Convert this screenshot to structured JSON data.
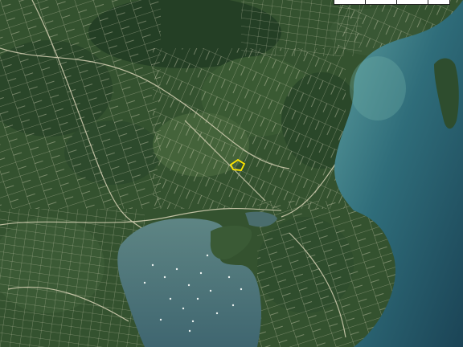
{
  "map": {
    "type": "satellite-parcel-map",
    "colors": {
      "forest_dark": "#1f3a22",
      "forest": "#34522f",
      "forest_light": "#5a7441",
      "sea_deep": "#1b4456",
      "sea_shallow": "#4e8e92",
      "bay": "#4f7579",
      "parcel_line": "#e8e2c8",
      "selected_parcel": "#ffe600",
      "scale_bar": "#ffffff"
    },
    "scale_bar_segments": 4,
    "selected_parcel": true
  }
}
